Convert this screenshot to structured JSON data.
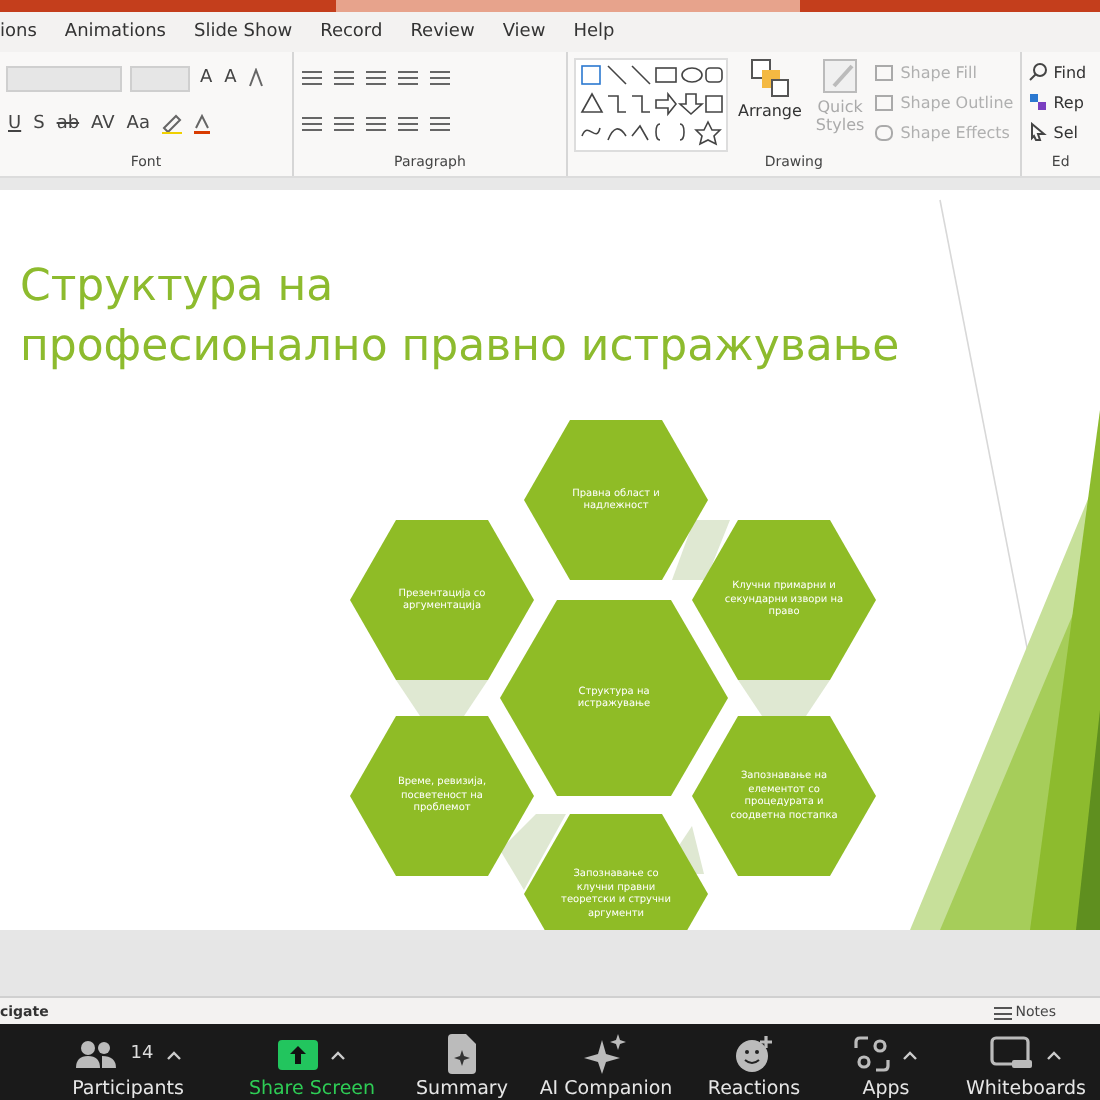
{
  "menu_tabs": [
    "ions",
    "Animations",
    "Slide Show",
    "Record",
    "Review",
    "View",
    "Help"
  ],
  "ribbon": {
    "font_size_buttons": [
      "A",
      "A"
    ],
    "font_buttons": [
      "U",
      "S",
      "ab",
      "AV",
      "Aa"
    ],
    "groups": [
      {
        "kind": "font",
        "label": "Font"
      },
      {
        "kind": "paragraph",
        "label": "Paragraph"
      },
      {
        "kind": "drawing",
        "label": "Drawing"
      },
      {
        "kind": "editing",
        "label": "Ed"
      }
    ],
    "arrange": "Arrange",
    "quick_styles": {
      "label": "Quick Styles",
      "disabled": true
    },
    "shape_format": [
      {
        "kind": "fill",
        "label": "Shape Fill",
        "disabled": true
      },
      {
        "kind": "outline",
        "label": "Shape Outline",
        "disabled": true
      },
      {
        "kind": "effects",
        "label": "Shape Effects",
        "disabled": true
      }
    ],
    "editing": [
      {
        "kind": "find",
        "label": "Find"
      },
      {
        "kind": "replace",
        "label": "Rep"
      },
      {
        "kind": "select",
        "label": "Sel"
      }
    ]
  },
  "slide": {
    "title_lines": [
      "Структура на",
      "професионално правно истражување"
    ],
    "diagram": {
      "center": "Структура на истражување",
      "nodes": [
        {
          "label": "Правна област и надлежност"
        },
        {
          "label": "Презентација со аргументација"
        },
        {
          "label": "Клучни примарни и секундарни извори на право"
        },
        {
          "label": "Време, ревизија, посветеност на проблемот"
        },
        {
          "label": "Запознавање на елементот со процедурата и соодветна постапка"
        },
        {
          "label": "Запознавање со клучни правни теоретски и стручни аргументи"
        }
      ]
    }
  },
  "status_bar": {
    "left": "cigate",
    "notes": "Notes"
  },
  "meeting_toolbar": [
    {
      "kind": "participants",
      "label": "Participants",
      "count": "14",
      "menu": true
    },
    {
      "kind": "share",
      "label": "Share Screen",
      "menu": true
    },
    {
      "kind": "summary",
      "label": "Summary",
      "menu": false
    },
    {
      "kind": "ai",
      "label": "AI Companion",
      "menu": false
    },
    {
      "kind": "reactions",
      "label": "Reactions",
      "menu": false
    },
    {
      "kind": "apps",
      "label": "Apps",
      "menu": true
    },
    {
      "kind": "whiteboards",
      "label": "Whiteboards",
      "menu": true
    }
  ]
}
